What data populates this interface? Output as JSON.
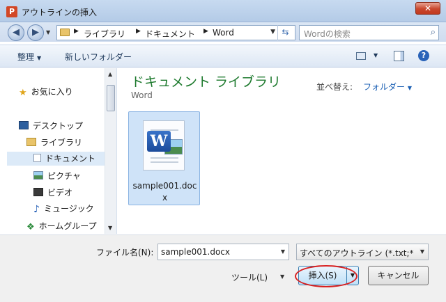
{
  "window": {
    "app_icon_letter": "P",
    "title": "アウトラインの挿入",
    "close_glyph": "✕"
  },
  "navigation": {
    "back_glyph": "◀",
    "forward_glyph": "▶",
    "breadcrumb": [
      "ライブラリ",
      "ドキュメント",
      "Word"
    ],
    "refresh_glyph": "⇆",
    "search_placeholder": "Wordの検索",
    "search_glyph": "⌕"
  },
  "toolbar": {
    "organize_label": "整理",
    "new_folder_label": "新しいフォルダー",
    "help_glyph": "?"
  },
  "sidebar": {
    "items": [
      {
        "label": "お気に入り",
        "icon": "star-icon"
      },
      {
        "label": "デスクトップ",
        "icon": "desktop-icon"
      },
      {
        "label": "ライブラリ",
        "icon": "library-icon"
      },
      {
        "label": "ドキュメント",
        "icon": "document-icon"
      },
      {
        "label": "ピクチャ",
        "icon": "picture-icon"
      },
      {
        "label": "ビデオ",
        "icon": "video-icon"
      },
      {
        "label": "ミュージック",
        "icon": "music-icon"
      },
      {
        "label": "ホームグループ",
        "icon": "homegroup-icon"
      }
    ]
  },
  "content": {
    "library_title": "ドキュメント ライブラリ",
    "library_subtitle": "Word",
    "arrange_label": "並べ替え:",
    "arrange_value": "フォルダー",
    "files": [
      {
        "name": "sample001.docx",
        "icon": "word-document-icon"
      }
    ]
  },
  "footer": {
    "filename_label": "ファイル名(N):",
    "filename_value": "sample001.docx",
    "filetype_value": "すべてのアウトライン (*.txt;*",
    "tools_label": "ツール(L)",
    "insert_label": "挿入(S)",
    "cancel_label": "キャンセル"
  },
  "colors": {
    "library_title": "#1e7a2e",
    "accent_link": "#1a5fb4",
    "highlight_ring": "#d92121",
    "selection": "#cfe3f8"
  }
}
